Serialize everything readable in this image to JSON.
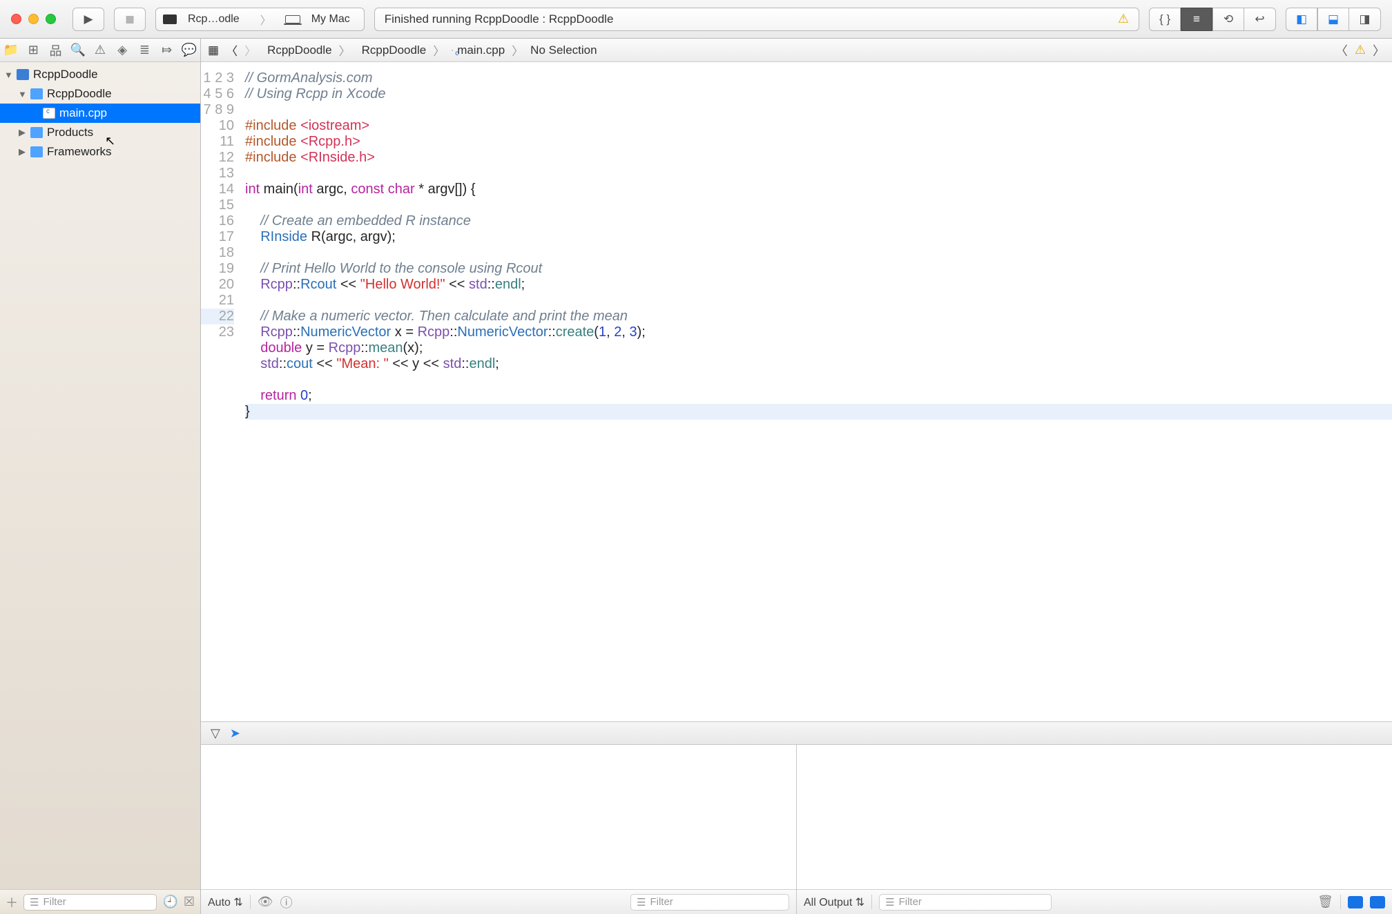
{
  "toolbar": {
    "scheme_target": "Rcp…odle",
    "scheme_device": "My Mac",
    "status_text": "Finished running RcppDoodle : RcppDoodle"
  },
  "navigator": {
    "project": "RcppDoodle",
    "group": "RcppDoodle",
    "file": "main.cpp",
    "products": "Products",
    "frameworks": "Frameworks",
    "filter_placeholder": "Filter"
  },
  "jumpbar": {
    "project": "RcppDoodle",
    "group": "RcppDoodle",
    "file": "main.cpp",
    "selection": "No Selection"
  },
  "code": {
    "l1": "// GormAnalysis.com",
    "l2": "// Using Rcpp in Xcode",
    "l4a": "#include ",
    "l4b": "<iostream>",
    "l5a": "#include ",
    "l5b": "<Rcpp.h>",
    "l6a": "#include ",
    "l6b": "<RInside.h>",
    "l8_int": "int",
    "l8_main": " main(",
    "l8_int2": "int",
    "l8_argc": " argc, ",
    "l8_const": "const",
    "l8_char": " char",
    "l8_rest": " * argv[]) {",
    "l10": "    // Create an embedded R instance",
    "l11a": "    ",
    "l11b": "RInside",
    "l11c": " R(argc, argv);",
    "l13": "    // Print Hello World to the console using Rcout",
    "l14a": "    ",
    "l14b": "Rcpp",
    "l14c": "::",
    "l14d": "Rcout",
    "l14e": " << ",
    "l14f": "\"Hello World!\"",
    "l14g": " << ",
    "l14h": "std",
    "l14i": "::",
    "l14j": "endl",
    "l14k": ";",
    "l16": "    // Make a numeric vector. Then calculate and print the mean",
    "l17a": "    ",
    "l17b": "Rcpp",
    "l17c": "::",
    "l17d": "NumericVector",
    "l17e": " x = ",
    "l17f": "Rcpp",
    "l17g": "::",
    "l17h": "NumericVector",
    "l17i": "::",
    "l17j": "create",
    "l17k": "(",
    "l17n1": "1",
    "l17m1": ", ",
    "l17n2": "2",
    "l17m2": ", ",
    "l17n3": "3",
    "l17z": ");",
    "l18a": "    ",
    "l18b": "double",
    "l18c": " y = ",
    "l18d": "Rcpp",
    "l18e": "::",
    "l18f": "mean",
    "l18g": "(x);",
    "l19a": "    ",
    "l19b": "std",
    "l19c": "::",
    "l19d": "cout",
    "l19e": " << ",
    "l19f": "\"Mean: \"",
    "l19g": " << y << ",
    "l19h": "std",
    "l19i": "::",
    "l19j": "endl",
    "l19k": ";",
    "l21a": "    ",
    "l21b": "return",
    "l21c": " ",
    "l21d": "0",
    "l21e": ";",
    "l22": "}"
  },
  "debug": {
    "vars_mode": "Auto",
    "console_mode": "All Output",
    "filter_placeholder": "Filter"
  }
}
